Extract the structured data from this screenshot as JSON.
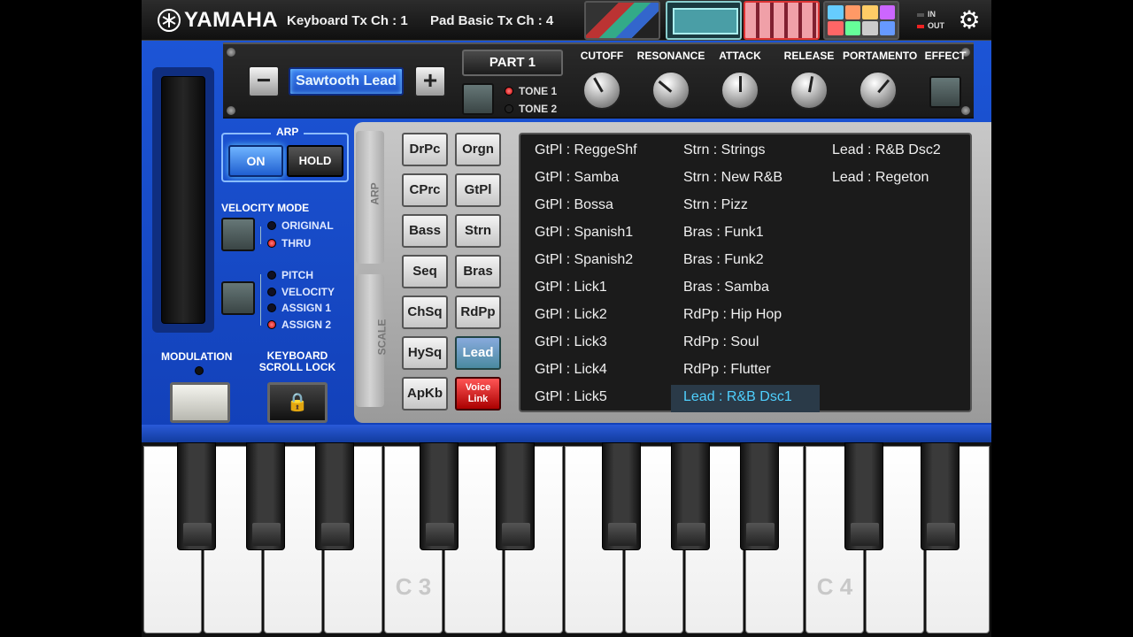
{
  "brand": {
    "name": "YAMAHA"
  },
  "topbar": {
    "keyboard_tx": "Keyboard Tx Ch : 1",
    "pad_tx": "Pad Basic Tx Ch : 4",
    "in_label": "IN",
    "out_label": "OUT",
    "settings_icon": "gear-icon"
  },
  "voice": {
    "minus": "−",
    "name": "Sawtooth Lead",
    "plus": "+",
    "part": "PART 1",
    "tone1": "TONE 1",
    "tone2": "TONE 2"
  },
  "knobs": {
    "cutoff": "CUTOFF",
    "resonance": "RESONANCE",
    "attack": "ATTACK",
    "release": "RELEASE",
    "portamento": "PORTAMENTO",
    "effect": "EFFECT"
  },
  "arp": {
    "title": "ARP",
    "on": "ON",
    "hold": "HOLD"
  },
  "velocity_mode": {
    "title": "VELOCITY MODE",
    "original": "ORIGINAL",
    "thru": "THRU"
  },
  "assign": {
    "pitch": "PITCH",
    "velocity": "VELOCITY",
    "assign1": "ASSIGN 1",
    "assign2": "ASSIGN 2"
  },
  "modulation": {
    "label": "MODULATION"
  },
  "scroll_lock": {
    "line1": "KEYBOARD",
    "line2": "SCROLL LOCK"
  },
  "side_tabs": {
    "arp": "ARP",
    "scale": "SCALE"
  },
  "categories": {
    "left": [
      "DrPc",
      "CPrc",
      "Bass",
      "Seq",
      "ChSq",
      "HySq",
      "ApKb"
    ],
    "right": [
      "Orgn",
      "GtPl",
      "Strn",
      "Bras",
      "RdPp",
      "Lead"
    ],
    "selected": "Lead",
    "voice_link_1": "Voice",
    "voice_link_2": "Link"
  },
  "voice_list": {
    "col1": [
      "GtPl : ReggeShf",
      "GtPl : Samba",
      "GtPl : Bossa",
      "GtPl : Spanish1",
      "GtPl : Spanish2",
      "GtPl : Lick1",
      "GtPl : Lick2",
      "GtPl : Lick3",
      "GtPl : Lick4",
      "GtPl : Lick5"
    ],
    "col2": [
      "Strn : Strings",
      "Strn : New R&B",
      "Strn : Pizz",
      "Bras : Funk1",
      "Bras : Funk2",
      "Bras : Samba",
      "RdPp : Hip Hop",
      "RdPp : Soul",
      "RdPp : Flutter",
      "Lead : R&B Dsc1"
    ],
    "col3": [
      "Lead : R&B Dsc2",
      "Lead : Regeton"
    ],
    "selected": "Lead : R&B Dsc1"
  },
  "keyboard": {
    "c3": "C 3",
    "c4": "C 4"
  },
  "colors": {
    "accent_blue": "#1c55d6",
    "selected_text": "#4fd0ff",
    "led_red": "#e22222"
  }
}
